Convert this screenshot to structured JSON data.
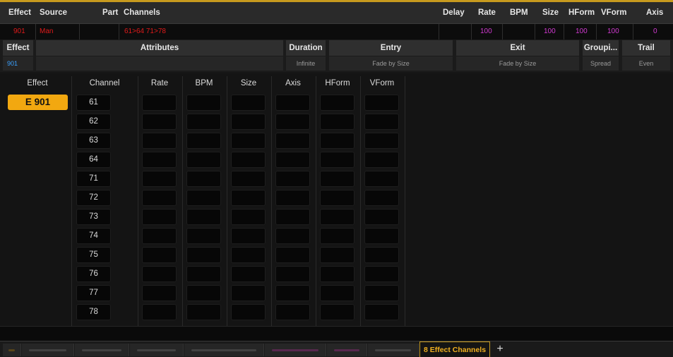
{
  "effect_list": {
    "headers": {
      "effect": "Effect",
      "source": "Source",
      "part": "Part",
      "channels": "Channels",
      "delay": "Delay",
      "rate": "Rate",
      "bpm": "BPM",
      "size": "Size",
      "hform": "HForm",
      "vform": "VForm",
      "axis": "Axis"
    },
    "row": {
      "effect": "901",
      "source": "Man",
      "part": "",
      "channels": "61>64 71>78",
      "delay": "",
      "rate": "100",
      "bpm": "",
      "size": "100",
      "hform": "100",
      "vform": "100",
      "axis": "0"
    },
    "colors": {
      "effect": "#e01a1a",
      "source": "#e01a1a",
      "channels": "#e01a1a",
      "rate": "#d23ad2",
      "size": "#d23ad2",
      "hform": "#d23ad2",
      "vform": "#d23ad2",
      "axis": "#d23ad2"
    }
  },
  "effect_detail": {
    "effect": {
      "label": "Effect",
      "value": "901"
    },
    "attributes": {
      "label": "Attributes",
      "value": ""
    },
    "duration": {
      "label": "Duration",
      "value": "Infinite"
    },
    "entry": {
      "label": "Entry",
      "value": "Fade by Size"
    },
    "exit": {
      "label": "Exit",
      "value": "Fade by Size"
    },
    "grouping": {
      "label": "Groupi...",
      "value": "Spread"
    },
    "trail": {
      "label": "Trail",
      "value": "Even"
    }
  },
  "grid": {
    "headers": {
      "effect": "Effect",
      "channel": "Channel",
      "rate": "Rate",
      "bpm": "BPM",
      "size": "Size",
      "axis": "Axis",
      "hform": "HForm",
      "vform": "VForm"
    },
    "effect_tag": "E 901",
    "channels": [
      "61",
      "62",
      "63",
      "64",
      "71",
      "72",
      "73",
      "74",
      "75",
      "76",
      "77",
      "78"
    ]
  },
  "tabs": {
    "active_label": "8 Effect Channels",
    "add_label": "+"
  },
  "colors": {
    "accent": "#f2a810",
    "blue_value": "#3aa0ff"
  }
}
